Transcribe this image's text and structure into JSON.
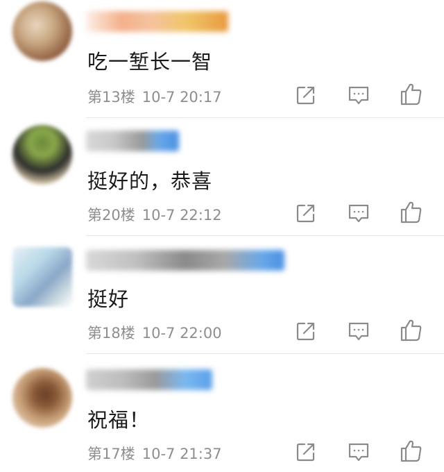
{
  "comments": [
    {
      "text": "吃一堑长一智",
      "floor": "第13楼",
      "time": "10-7 20:17",
      "avatar_colors": [
        "#c9a882",
        "#8b5a3c",
        "#e8d5c0"
      ],
      "name_colors": [
        "#f3b08a",
        "#f0c66a",
        "#e89a40"
      ]
    },
    {
      "text": "挺好的，恭喜",
      "floor": "第20楼",
      "time": "10-7 22:12",
      "avatar_colors": [
        "#6b8a3a",
        "#2c2c2c",
        "#d8c8a8"
      ],
      "name_colors": [
        "#c8c8c8",
        "#9a9a9a",
        "#6aa8e8"
      ]
    },
    {
      "text": "挺好",
      "floor": "第18楼",
      "time": "10-7 22:00",
      "avatar_colors": [
        "#b8d8e8",
        "#8aa8c8",
        "#e8f0f5"
      ],
      "name_colors": [
        "#c0c0c0",
        "#8a8a8a",
        "#6aa8e8"
      ]
    },
    {
      "text": "祝福！",
      "floor": "第17楼",
      "time": "10-7 21:37",
      "avatar_colors": [
        "#6a4028",
        "#c8a078",
        "#e8d0b8"
      ],
      "name_colors": [
        "#bcbcbc",
        "#9a9a9a",
        "#7ab8f0"
      ]
    }
  ]
}
